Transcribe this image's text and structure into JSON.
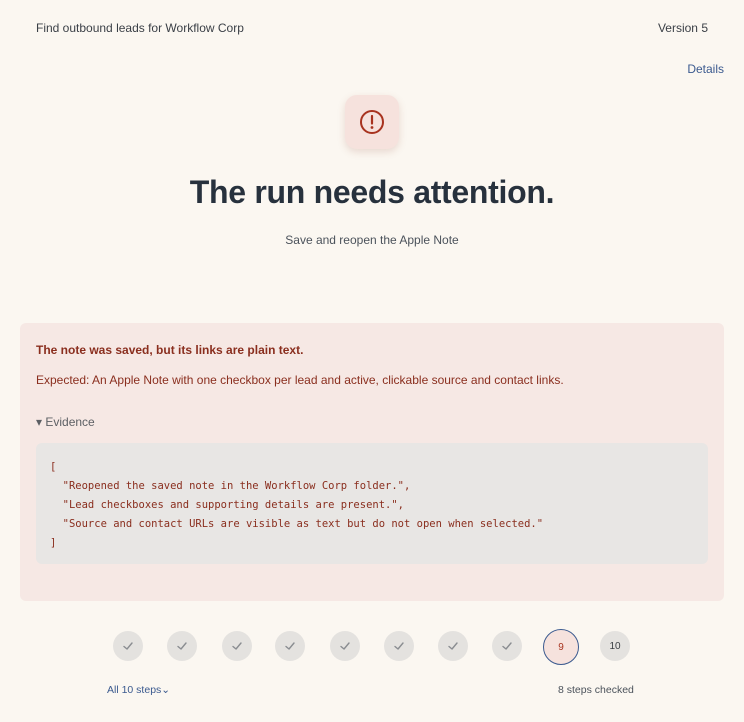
{
  "header": {
    "task_title": "Find outbound leads for Workflow Corp",
    "version": "Version 5",
    "details_link": "Details"
  },
  "status": {
    "icon": "alert-circle-icon",
    "headline": "The run needs attention.",
    "subline": "Save and reopen the Apple Note"
  },
  "issue": {
    "title": "The note was saved, but its links are plain text.",
    "expected": "Expected: An Apple Note with one checkbox per lead and active, clickable source and contact links.",
    "evidence_toggle": "▾ Evidence",
    "evidence": "[\n  \"Reopened the saved note in the Workflow Corp folder.\",\n  \"Lead checkboxes and supporting details are present.\",\n  \"Source and contact URLs are visible as text but do not open when selected.\"\n]"
  },
  "steps": {
    "items": [
      {
        "state": "done"
      },
      {
        "state": "done"
      },
      {
        "state": "done"
      },
      {
        "state": "done"
      },
      {
        "state": "done"
      },
      {
        "state": "done"
      },
      {
        "state": "done"
      },
      {
        "state": "done"
      },
      {
        "state": "current",
        "label": "9"
      },
      {
        "state": "pending",
        "label": "10"
      }
    ],
    "all_steps_label": "All 10 steps⌄",
    "checked_label": "8 steps checked"
  },
  "colors": {
    "background": "#fbf7f1",
    "panel": "#f6e8e4",
    "error_text": "#8a2e1e",
    "accent": "#3b5a8f"
  }
}
